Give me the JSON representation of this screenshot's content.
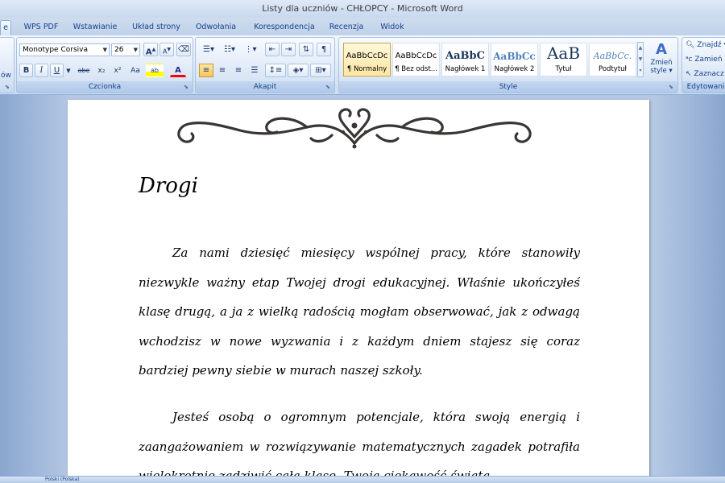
{
  "window": {
    "title": "Listy dla uczniów - CHŁOPCY - Microsoft Word"
  },
  "tabs": [
    {
      "label": "e",
      "key": "home"
    },
    {
      "label": "WPS PDF"
    },
    {
      "label": "Wstawianie"
    },
    {
      "label": "Układ strony"
    },
    {
      "label": "Odwołania"
    },
    {
      "label": "Korespondencja"
    },
    {
      "label": "Recenzja"
    },
    {
      "label": "Widok"
    }
  ],
  "ribbon": {
    "clipboard_partial": "ów",
    "font": {
      "name": "Monotype Corsiva",
      "size": "26",
      "group_label": "Czcionka",
      "grow": "A",
      "shrink": "A",
      "bold": "B",
      "italic": "I",
      "underline": "U",
      "strike": "abe",
      "subscript": "x₂",
      "superscript": "x²",
      "case": "Aa",
      "font_color": "A"
    },
    "paragraph": {
      "group_label": "Akapit",
      "pilcrow": "¶"
    },
    "styles": {
      "group_label": "Style",
      "items": [
        {
          "sample": "AaBbCcDc",
          "name": "¶ Normalny",
          "selected": true
        },
        {
          "sample": "AaBbCcDc",
          "name": "¶ Bez odst..."
        },
        {
          "sample": "AaBbC",
          "name": "Nagłówek 1"
        },
        {
          "sample": "AaBbCc",
          "name": "Nagłówek 2"
        },
        {
          "sample": "AaB",
          "name": "Tytuł"
        },
        {
          "sample": "AaBbCc.",
          "name": "Podtytuł"
        }
      ],
      "change_label_1": "Zmień",
      "change_label_2": "style"
    },
    "editing": {
      "group_label": "Edytowani",
      "find": "Znajdź",
      "replace": "Zamień",
      "select": "Zaznacz"
    }
  },
  "document": {
    "heading": "Drogi",
    "paragraphs": [
      "Za nami dziesięć miesięcy wspólnej pracy, które stanowiły niezwykle ważny etap Twojej drogi edukacyjnej. Właśnie ukończyłeś klasę drugą, a ja z wielką radością mogłam obserwować, jak z odwagą wchodzisz w nowe wyzwania i z każdym dniem stajesz się coraz bardziej pewny siebie w murach naszej szkoły.",
      "Jesteś osobą o ogromnym potencjale, która swoją energią i zaangażowaniem w rozwiązywanie matematycznych zagadek potrafiła wielokrotnie zadziwić całą klasę. Twoja ciekawość świata"
    ]
  },
  "statusbar": {
    "language": "Polski (Polska)"
  },
  "colors": {
    "ribbon_text": "#15428b",
    "highlight": "#fde8a6",
    "font_color_bar": "#ff0000"
  }
}
